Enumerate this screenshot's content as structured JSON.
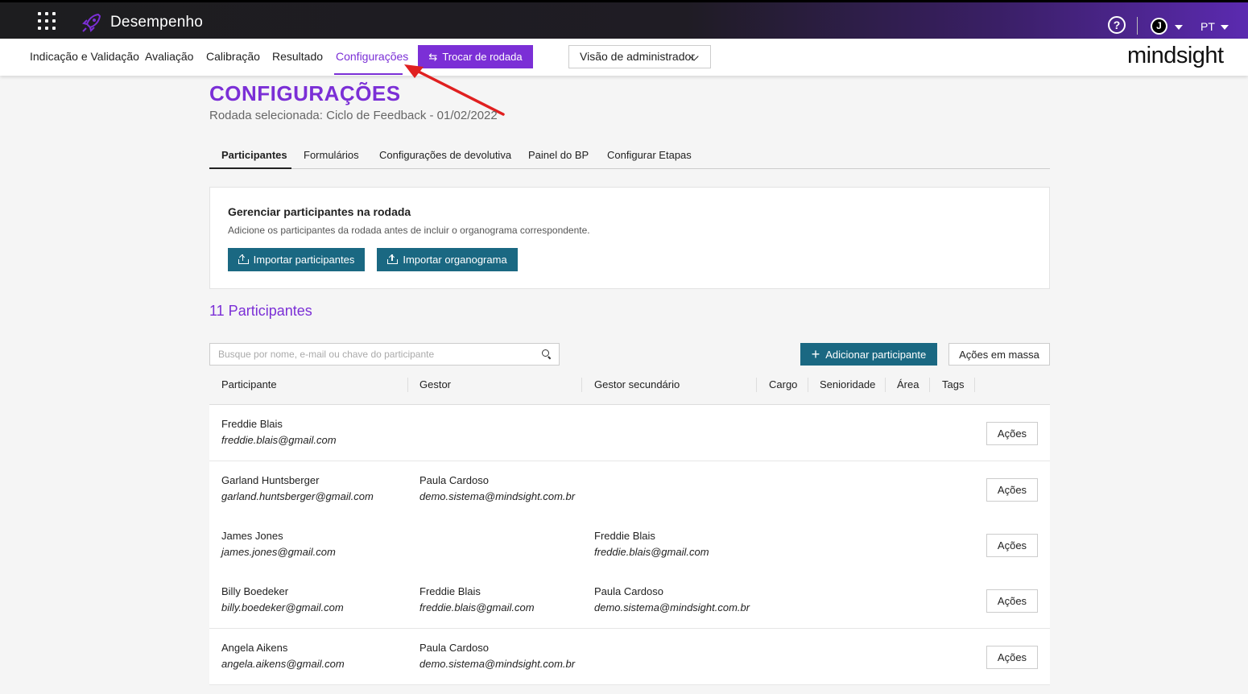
{
  "app": {
    "title": "Desempenho",
    "language": "PT",
    "avatar_initial": "J",
    "logo": "mindsight"
  },
  "nav": {
    "items": [
      "Indicação e Validação",
      "Avaliação",
      "Calibração",
      "Resultado",
      "Configurações"
    ],
    "switch_button": "Trocar de rodada",
    "view_select": "Visão de administrador"
  },
  "page": {
    "title": "CONFIGURAÇÕES",
    "round": "Rodada selecionada: Ciclo de Feedback - 01/02/2022",
    "tabs": [
      "Participantes",
      "Formulários",
      "Configurações de devolutiva",
      "Painel do BP",
      "Configurar Etapas"
    ]
  },
  "card": {
    "title": "Gerenciar participantes na rodada",
    "subtitle": "Adicione os participantes da rodada antes de incluir o organograma correspondente.",
    "import_participants": "Importar participantes",
    "import_org": "Importar organograma"
  },
  "participants": {
    "count_label": "11 Participantes",
    "search_placeholder": "Busque por nome, e-mail ou chave do participante",
    "add_button": "Adicionar participante",
    "bulk_button": "Ações em massa",
    "columns": [
      "Participante",
      "Gestor",
      "Gestor secundário",
      "Cargo",
      "Senioridade",
      "Área",
      "Tags"
    ],
    "action_label": "Ações",
    "rows": [
      {
        "name": "Freddie Blais",
        "email": "freddie.blais@gmail.com",
        "manager": "",
        "manager_email": "",
        "secondary": "",
        "secondary_email": ""
      },
      {
        "name": "Garland Huntsberger",
        "email": "garland.huntsberger@gmail.com",
        "manager": "Paula Cardoso",
        "manager_email": "demo.sistema@mindsight.com.br",
        "secondary": "",
        "secondary_email": ""
      },
      {
        "name": "James Jones",
        "email": "james.jones@gmail.com",
        "manager": "",
        "manager_email": "",
        "secondary": "Freddie Blais",
        "secondary_email": "freddie.blais@gmail.com"
      },
      {
        "name": "Billy Boedeker",
        "email": "billy.boedeker@gmail.com",
        "manager": "Freddie Blais",
        "manager_email": "freddie.blais@gmail.com",
        "secondary": "Paula Cardoso",
        "secondary_email": "demo.sistema@mindsight.com.br"
      },
      {
        "name": "Angela Aikens",
        "email": "angela.aikens@gmail.com",
        "manager": "Paula Cardoso",
        "manager_email": "demo.sistema@mindsight.com.br",
        "secondary": "",
        "secondary_email": ""
      }
    ]
  },
  "colors": {
    "accent": "#7b2fd6",
    "primary_button": "#1a6882",
    "annotation_arrow": "#e02020"
  }
}
